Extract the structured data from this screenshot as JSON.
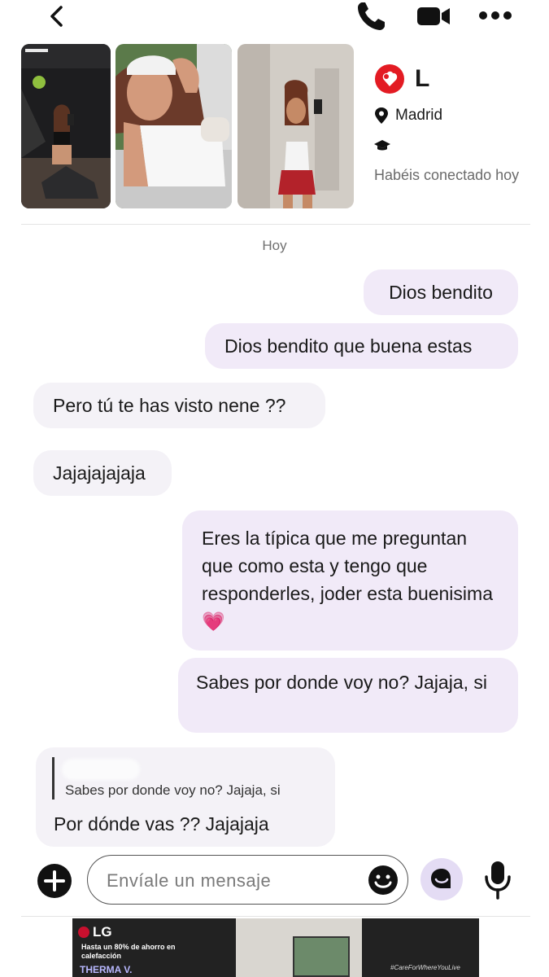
{
  "header": {
    "back_icon": "chevron-left-icon",
    "call_icon": "phone-icon",
    "video_icon": "video-camera-icon",
    "more_icon": "more-dots-icon"
  },
  "profile": {
    "name_initial": "L",
    "location": "Madrid",
    "connected_text": "Habéis conectado hoy",
    "accent_color": "#e31b23"
  },
  "chat": {
    "day_label": "Hoy",
    "messages": [
      {
        "side": "sent",
        "text": "Dios bendito"
      },
      {
        "side": "sent",
        "text": "Dios bendito que buena estas"
      },
      {
        "side": "received",
        "text": "Pero tú te has visto nene ??"
      },
      {
        "side": "received",
        "text": "Jajajajajaja"
      },
      {
        "side": "sent",
        "text": "Eres la típica que me preguntan que como esta y tengo que responderles, joder esta buenisima💗"
      },
      {
        "side": "sent",
        "text": "Sabes por donde voy no? Jajaja, si"
      },
      {
        "side": "received",
        "reply_to": "Sabes por donde voy no? Jajaja, si",
        "text": "Por dónde vas ?? Jajajaja"
      }
    ]
  },
  "composer": {
    "placeholder": "Envíale un mensaje",
    "plus_icon": "plus-circle-icon",
    "emoji_icon": "emoji-icon",
    "chat_icon": "chat-bubble-icon",
    "mic_icon": "microphone-icon"
  },
  "ad": {
    "brand": "LG",
    "copy": "Hasta un 80% de ahorro en calefacción",
    "product": "THERMA V.",
    "tagline": "#CareForWhereYouLive"
  }
}
